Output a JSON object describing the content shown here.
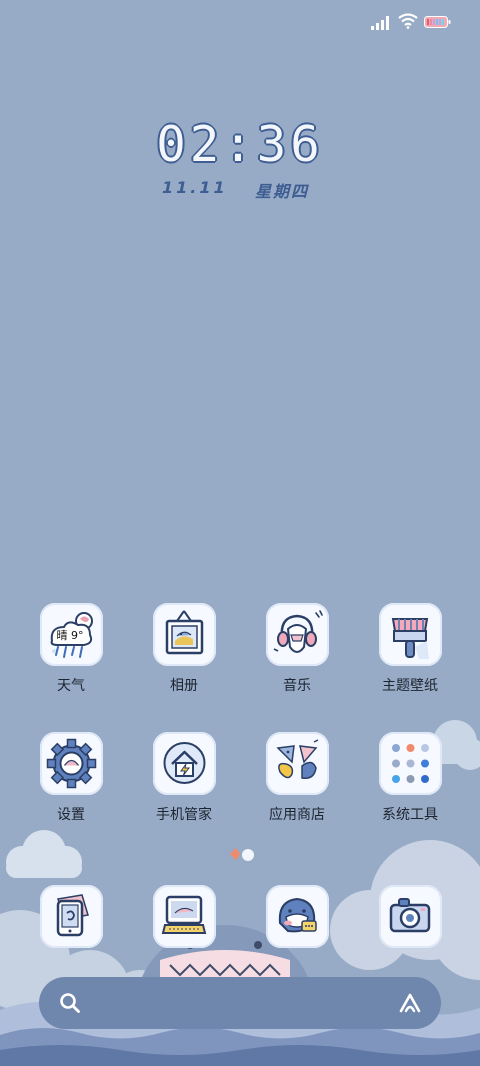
{
  "status": {
    "signal_icon": "signal-bars-icon",
    "wifi_icon": "wifi-icon",
    "battery_icon": "battery-icon"
  },
  "lockclock": {
    "time": "02:36",
    "date": "11.11",
    "weekday": "星期四"
  },
  "apps": [
    {
      "label": "天气",
      "icon": "weather-icon",
      "badge": "晴 9°"
    },
    {
      "label": "相册",
      "icon": "gallery-icon"
    },
    {
      "label": "音乐",
      "icon": "music-icon"
    },
    {
      "label": "主题壁纸",
      "icon": "theme-brush-icon"
    },
    {
      "label": "设置",
      "icon": "settings-gear-icon"
    },
    {
      "label": "手机管家",
      "icon": "phone-manager-icon"
    },
    {
      "label": "应用商店",
      "icon": "app-store-icon"
    },
    {
      "label": "系统工具",
      "icon": "system-tools-folder-icon"
    }
  ],
  "dock_apps": [
    {
      "icon": "phone-dialer-icon"
    },
    {
      "icon": "computer-icon"
    },
    {
      "icon": "messages-shark-icon"
    },
    {
      "icon": "camera-icon"
    }
  ],
  "search": {
    "search_icon": "search-icon",
    "assistant_icon": "assistant-a-icon"
  },
  "colors": {
    "background": "#97abc6",
    "accent": "#3e5d92",
    "dock": "#6f87ac"
  }
}
